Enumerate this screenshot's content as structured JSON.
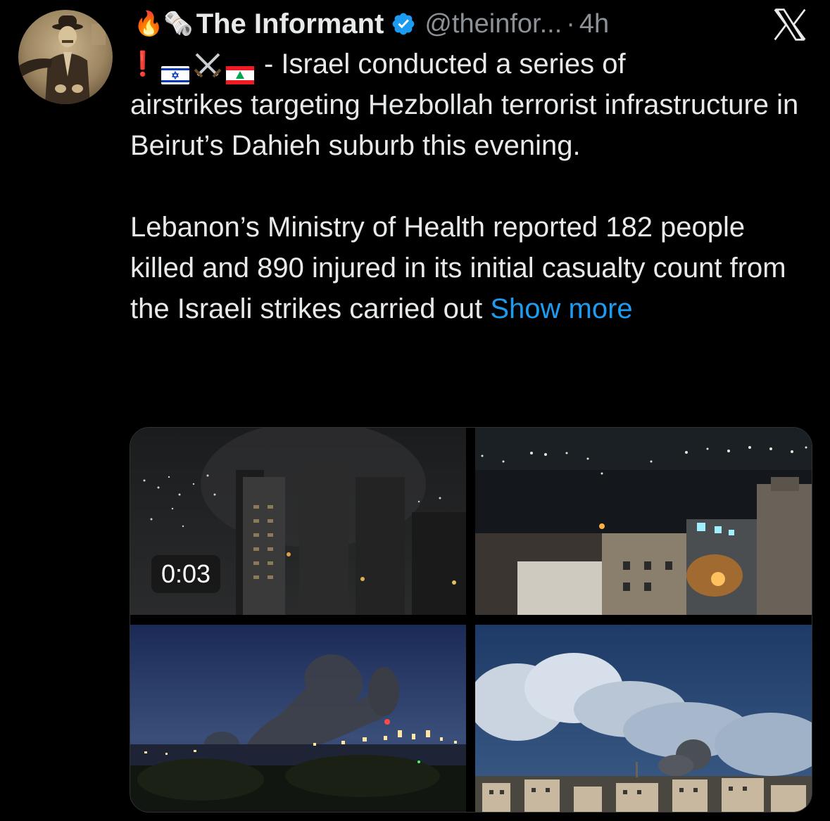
{
  "tweet": {
    "author": {
      "header_emojis": [
        "🔥",
        "🗞️"
      ],
      "display_name": "The Informant",
      "handle": "@theinfor...",
      "separator": "·",
      "time": "4h",
      "avatar_icon": "vintage-portrait-avatar",
      "verified_icon": "verified-badge-icon"
    },
    "platform_icon": "x-logo-icon",
    "text": {
      "prefix_emojis": [
        "❗",
        "🇮🇱",
        "⚔️",
        "🇱🇧"
      ],
      "line1": "- Israel conducted a series of",
      "paragraph1_rest": "airstrikes targeting Hezbollah terrorist infrastructure in Beirut’s Dahieh suburb this evening.",
      "paragraph2": "Lebanon’s Ministry of Health reported 182 people killed and 890 injured in its initial casualty count from the Israeli strikes carried out",
      "show_more": "Show more"
    },
    "media": {
      "video_duration": "0:03",
      "items": [
        {
          "kind": "video",
          "icon": "night-city-buildings-smoke"
        },
        {
          "kind": "image",
          "icon": "night-city-fire"
        },
        {
          "kind": "image",
          "icon": "smoke-plume-over-city"
        },
        {
          "kind": "image",
          "icon": "smoke-over-skyline-clouds"
        }
      ]
    },
    "colors": {
      "background": "#000000",
      "text": "#e7e9ea",
      "muted": "#8b9196",
      "link": "#1d9bf0",
      "verified": "#1d9bf0"
    }
  }
}
